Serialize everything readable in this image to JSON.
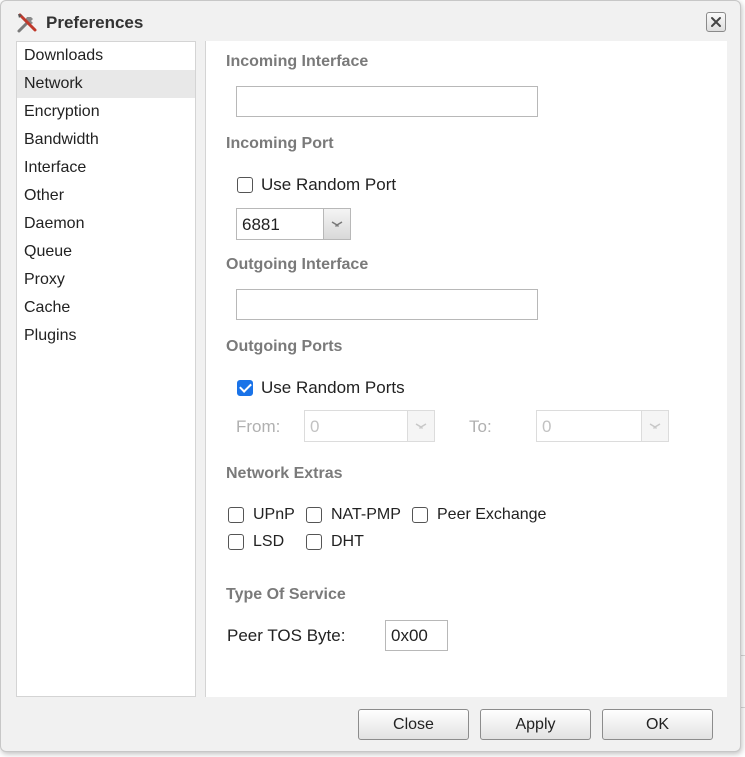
{
  "window": {
    "title": "Preferences",
    "title_icon": "tools-icon",
    "close_icon": "close-icon"
  },
  "sidebar": {
    "items": [
      {
        "label": "Downloads"
      },
      {
        "label": "Network",
        "selected": true
      },
      {
        "label": "Encryption"
      },
      {
        "label": "Bandwidth"
      },
      {
        "label": "Interface"
      },
      {
        "label": "Other"
      },
      {
        "label": "Daemon"
      },
      {
        "label": "Queue"
      },
      {
        "label": "Proxy"
      },
      {
        "label": "Cache"
      },
      {
        "label": "Plugins"
      }
    ]
  },
  "network": {
    "incoming_interface": {
      "title": "Incoming Interface",
      "value": ""
    },
    "incoming_port": {
      "title": "Incoming Port",
      "random_label": "Use Random Port",
      "random_checked": false,
      "port_value": "6881"
    },
    "outgoing_interface": {
      "title": "Outgoing Interface",
      "value": ""
    },
    "outgoing_ports": {
      "title": "Outgoing Ports",
      "random_label": "Use Random Ports",
      "random_checked": true,
      "from_label": "From:",
      "from_value": "0",
      "to_label": "To:",
      "to_value": "0"
    },
    "extras": {
      "title": "Network Extras",
      "upnp": {
        "label": "UPnP",
        "checked": false
      },
      "natpmp": {
        "label": "NAT-PMP",
        "checked": false
      },
      "peer_exchange": {
        "label": "Peer Exchange",
        "checked": false
      },
      "lsd": {
        "label": "LSD",
        "checked": false
      },
      "dht": {
        "label": "DHT",
        "checked": false
      }
    },
    "tos": {
      "title": "Type Of Service",
      "label": "Peer TOS Byte:",
      "value": "0x00"
    }
  },
  "footer": {
    "close": "Close",
    "apply": "Apply",
    "ok": "OK"
  },
  "colors": {
    "checkbox_checked": "#1a73e8",
    "section_title": "#7a7a7a"
  }
}
